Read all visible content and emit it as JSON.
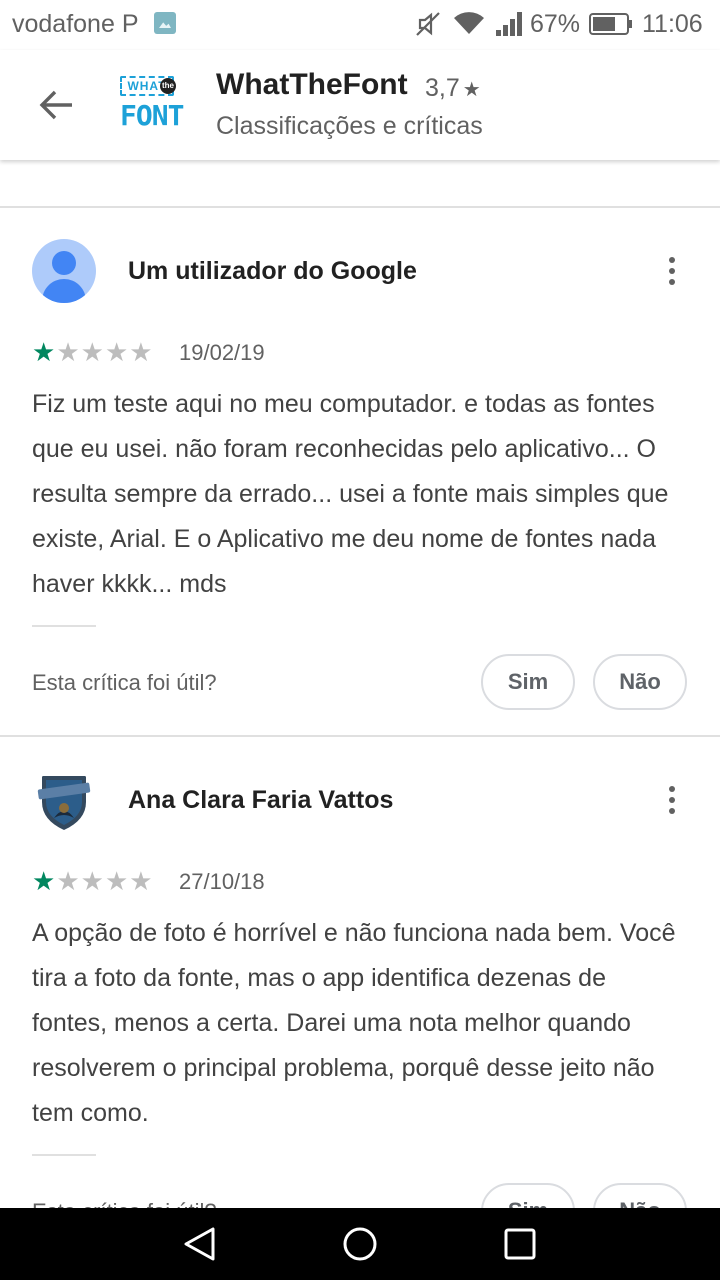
{
  "status_bar": {
    "carrier": "vodafone P",
    "battery": "67%",
    "time": "11:06"
  },
  "app_bar": {
    "title": "WhatTheFont",
    "rating": "3,7",
    "rating_star": "★",
    "subtitle": "Classificações e críticas",
    "logo": {
      "what": "WHAT",
      "the": "the",
      "font": "FONT"
    }
  },
  "reviews": [
    {
      "author": "Um utilizador do Google",
      "rating": 1,
      "date": "19/02/19",
      "text": "Fiz um teste aqui no meu computador. e todas as fontes que eu usei. não foram reconhecidas pelo aplicativo... O resulta sempre da errado... usei a fonte mais simples que existe, Arial. E o Aplicativo me deu nome de fontes nada haver kkkk... mds",
      "helpful_question": "Esta crítica foi útil?",
      "yes_label": "Sim",
      "no_label": "Não"
    },
    {
      "author": "Ana Clara Faria Vattos",
      "rating": 1,
      "date": "27/10/18",
      "text": "A opção de foto é horrível e não funciona nada bem. Você tira a foto da fonte, mas o app identifica dezenas de fontes, menos a certa. Darei uma nota melhor quando resolverem o principal problema, porquê desse jeito não tem como.",
      "helpful_question": "Esta crítica foi útil?",
      "yes_label": "Sim",
      "no_label": "Não",
      "avatar_text": "Ravenclaw"
    }
  ],
  "icons": {
    "back": "arrow-left-icon",
    "more": "more-vert-icon",
    "nav_back": "triangle-back-icon",
    "nav_home": "circle-home-icon",
    "nav_recents": "square-recents-icon"
  },
  "colors": {
    "star_on": "#01875f",
    "star_off": "#bdbdbd",
    "logo_blue": "#1da1d8",
    "avatar_blue": "#4285f4"
  }
}
